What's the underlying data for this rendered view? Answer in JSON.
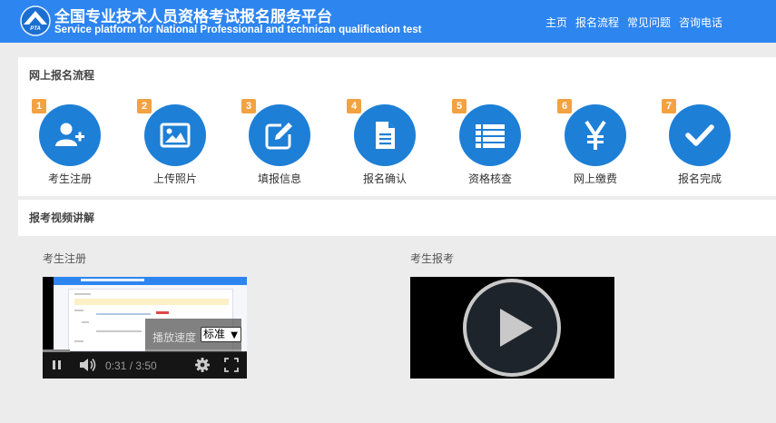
{
  "header": {
    "title_cn": "全国专业技术人员资格考试报名服务平台",
    "title_en": "Service platform for National Professional and technican qualification test",
    "logo_text": "PTA",
    "nav": [
      "主页",
      "报名流程",
      "常见问题",
      "咨询电话"
    ]
  },
  "process": {
    "heading": "网上报名流程",
    "steps": [
      {
        "num": "1",
        "label": "考生注册",
        "icon": "add-user-icon"
      },
      {
        "num": "2",
        "label": "上传照片",
        "icon": "image-icon"
      },
      {
        "num": "3",
        "label": "填报信息",
        "icon": "edit-icon"
      },
      {
        "num": "4",
        "label": "报名确认",
        "icon": "document-icon"
      },
      {
        "num": "5",
        "label": "资格核查",
        "icon": "list-icon"
      },
      {
        "num": "6",
        "label": "网上缴费",
        "icon": "yen-icon"
      },
      {
        "num": "7",
        "label": "报名完成",
        "icon": "checkmark-icon"
      }
    ]
  },
  "videos": {
    "heading": "报考视频讲解",
    "items": [
      {
        "caption": "考生注册",
        "speed_label": "播放速度",
        "speed_value": "标准",
        "time": "0:31 / 3:50",
        "progress": 0.135
      },
      {
        "caption": "考生报考"
      }
    ]
  },
  "colors": {
    "header_bg": "#2d85f0",
    "step_circle": "#1e7fd6",
    "step_badge": "#f3a242",
    "page_bg": "#ececec"
  }
}
